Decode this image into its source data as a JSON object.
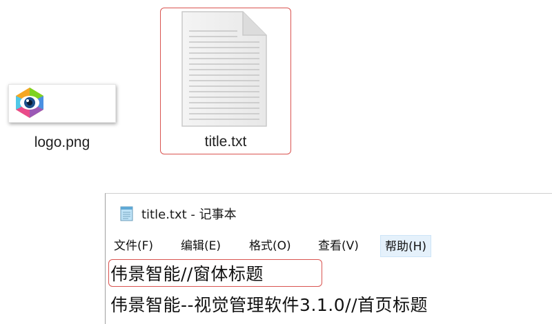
{
  "desktop": {
    "files": [
      {
        "name": "logo.png",
        "icon": "image-thumbnail-icon"
      },
      {
        "name": "title.txt",
        "icon": "text-document-icon",
        "selected": true
      }
    ]
  },
  "notepad": {
    "title": "title.txt - 记事本",
    "icon": "notepad-icon",
    "menu": [
      {
        "label": "文件(F)"
      },
      {
        "label": "编辑(E)"
      },
      {
        "label": "格式(O)"
      },
      {
        "label": "查看(V)"
      },
      {
        "label": "帮助(H)",
        "hovered": true
      }
    ],
    "lines": [
      "伟景智能//窗体标题",
      "伟景智能--视觉管理软件3.1.0//首页标题"
    ]
  },
  "colors": {
    "highlight_border": "#d9534f",
    "menu_hover_bg": "#e5f1fb"
  }
}
